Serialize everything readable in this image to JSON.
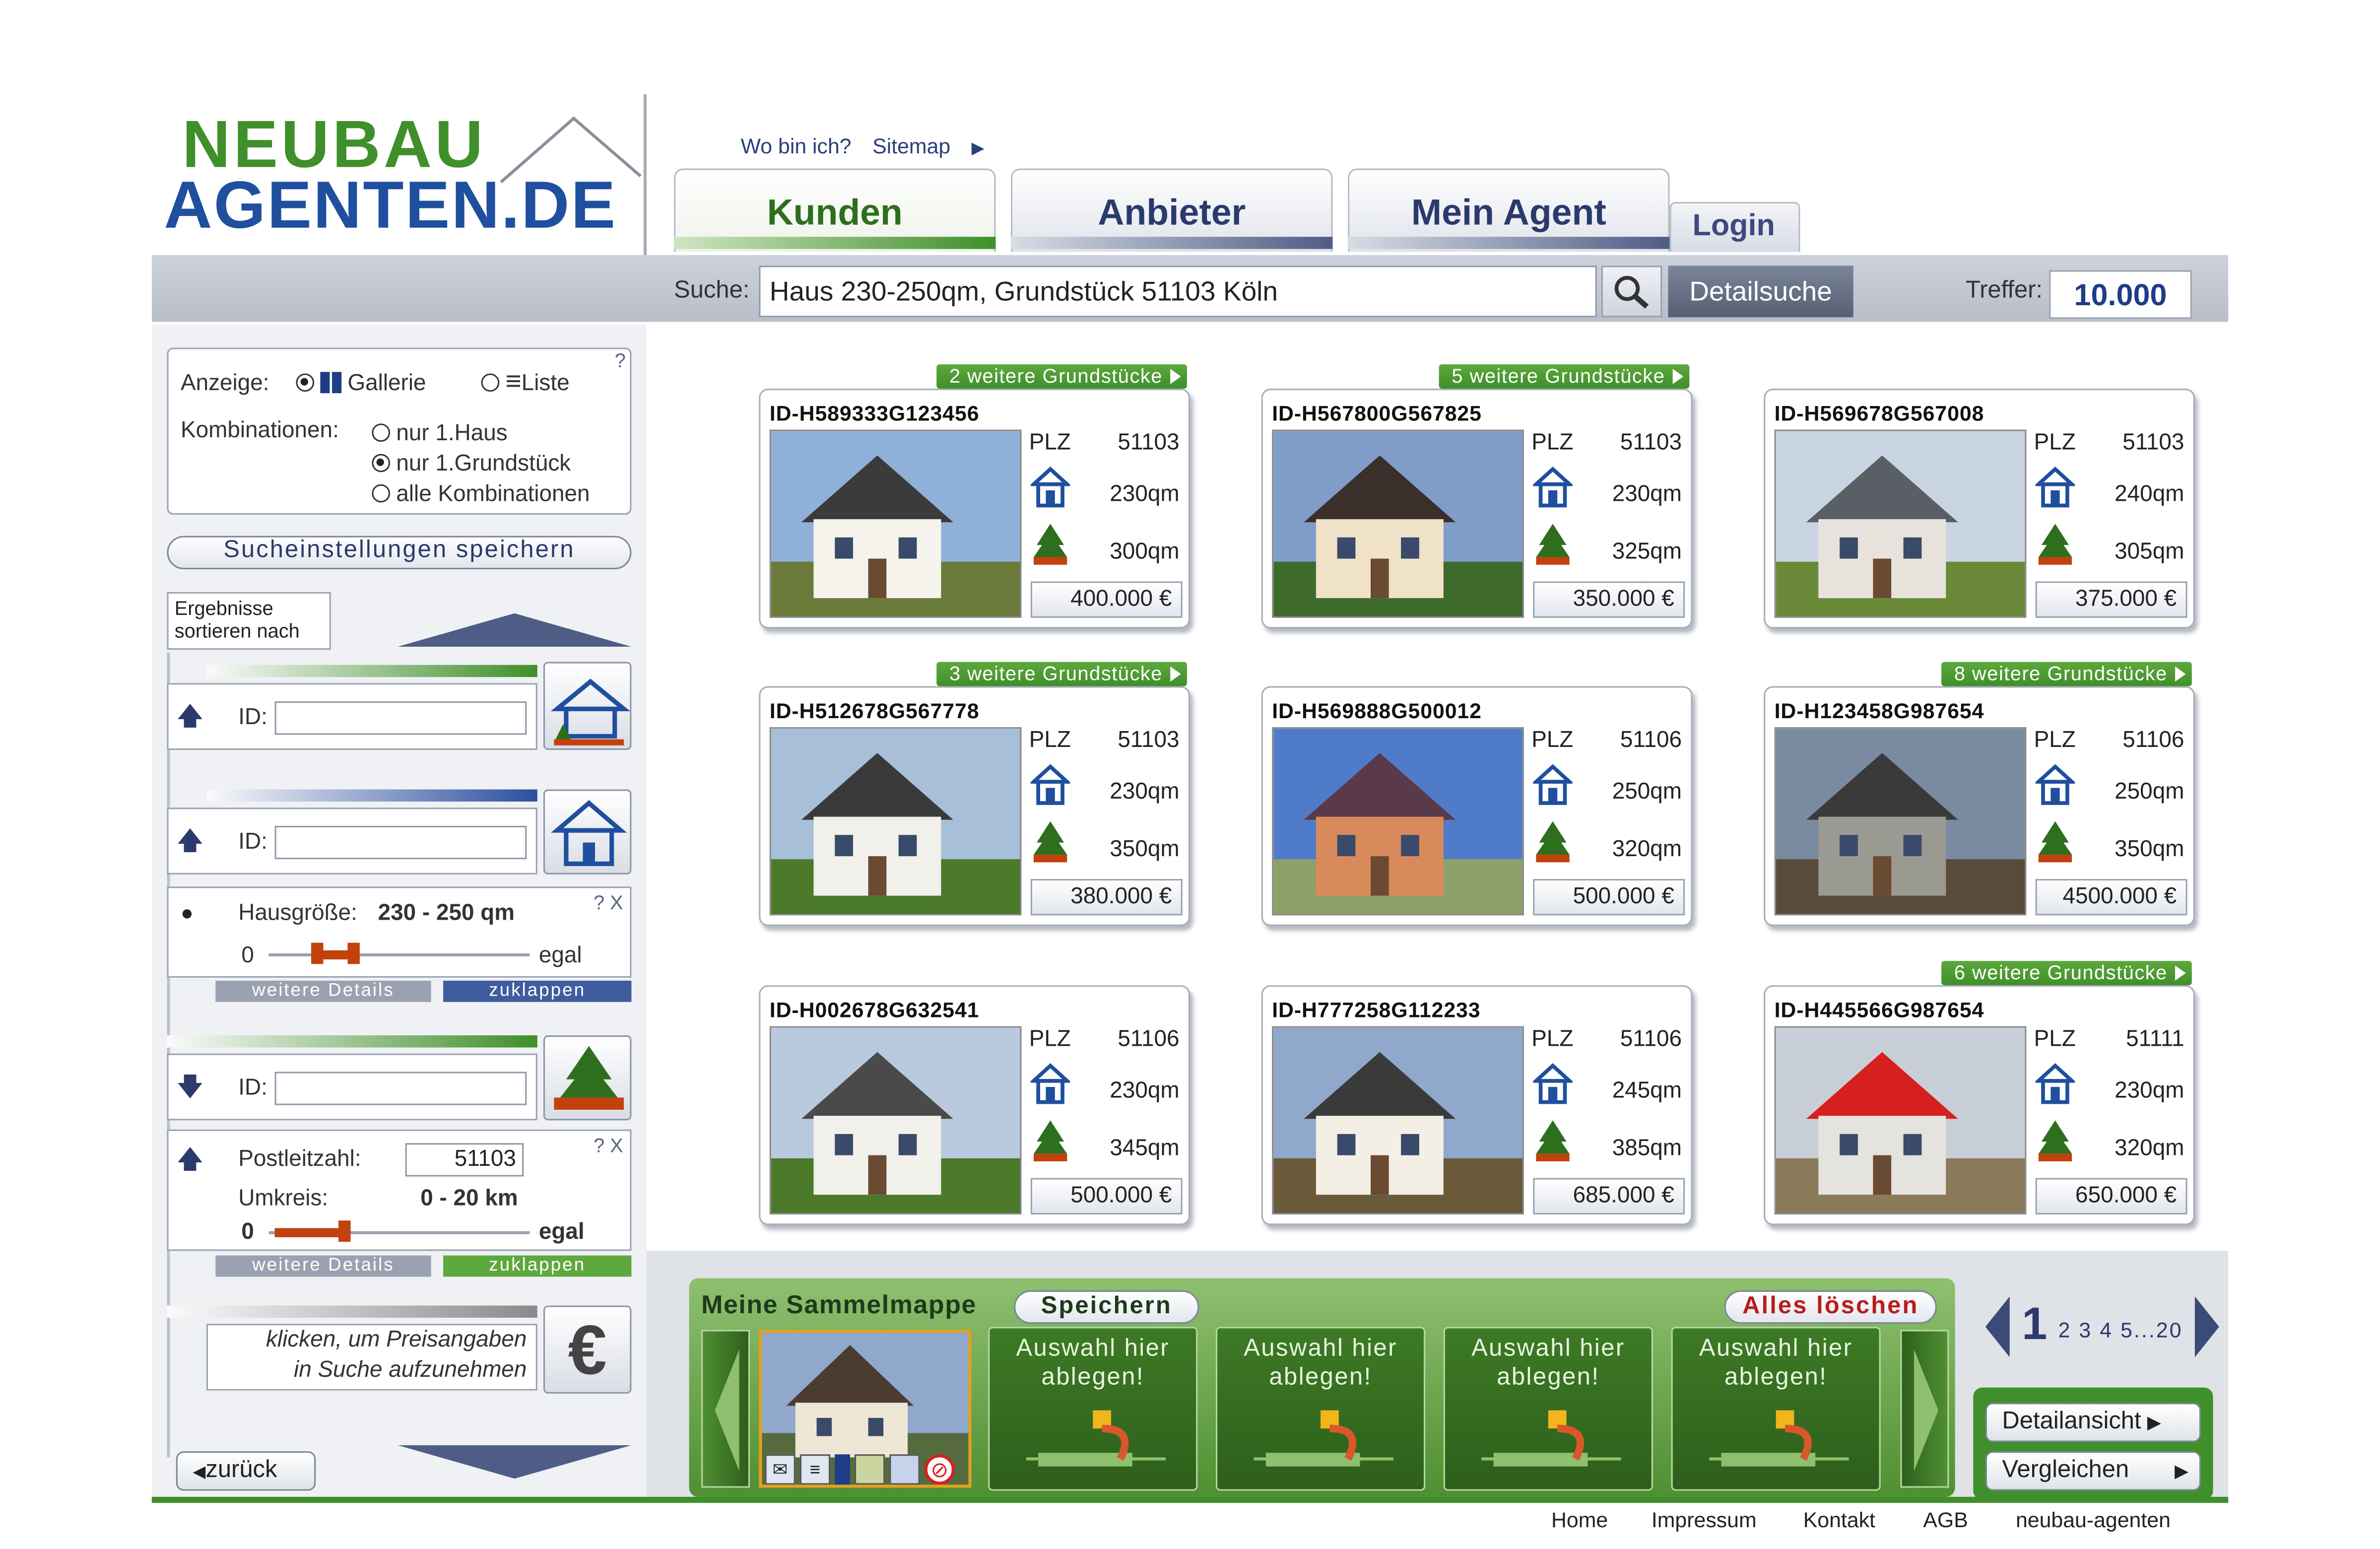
{
  "header": {
    "logo_line1": "NEUBAU",
    "logo_line2": "AGENTEN.DE",
    "breadcrumb": {
      "where": "Wo bin ich?",
      "sitemap": "Sitemap"
    },
    "tabs": [
      {
        "label": "Kunden",
        "active": true
      },
      {
        "label": "Anbieter",
        "active": false
      },
      {
        "label": "Mein Agent",
        "active": false
      }
    ],
    "login": "Login"
  },
  "search": {
    "label": "Suche:",
    "value": "Haus 230-250qm, Grundstück 51103 Köln",
    "detail_button": "Detailsuche",
    "hits_label": "Treffer:",
    "hits_value": "10.000"
  },
  "sidebar": {
    "display_label": "Anzeige:",
    "display_options": [
      "Gallerie",
      "Liste"
    ],
    "combinations_label": "Kombinationen:",
    "combination_options": [
      "nur 1.Haus",
      "nur 1.Grundstück",
      "alle Kombinationen"
    ],
    "help": "?",
    "save_settings": "Sucheinstellungen speichern",
    "sort_label": "Ergebnisse sortieren nach",
    "id_label": "ID:",
    "house_size_label": "Hausgröße:",
    "house_size_value": "230 - 250 qm",
    "range_min": "0",
    "range_max": "egal",
    "more_details": "weitere Details",
    "collapse": "zuklappen",
    "help_close": "? X",
    "postcode_label": "Postleitzahl:",
    "postcode_value": "51103",
    "radius_label": "Umkreis:",
    "radius_value": "0 - 20 km",
    "price_hint_line1": "klicken, um Preisangaben",
    "price_hint_line2": "in Suche aufzunehmen",
    "euro": "€",
    "back": "zurück"
  },
  "listings": [
    {
      "more": "2 weitere Grundstücke",
      "id": "ID-H589333G123456",
      "plz": "51103",
      "house": "230qm",
      "plot": "300qm",
      "price": "400.000 €"
    },
    {
      "more": "5 weitere Grundstücke",
      "id": "ID-H567800G567825",
      "plz": "51103",
      "house": "230qm",
      "plot": "325qm",
      "price": "350.000 €"
    },
    {
      "more": "",
      "id": "ID-H569678G567008",
      "plz": "51103",
      "house": "240qm",
      "plot": "305qm",
      "price": "375.000 €"
    },
    {
      "more": "3 weitere Grundstücke",
      "id": "ID-H512678G567778",
      "plz": "51103",
      "house": "230qm",
      "plot": "350qm",
      "price": "380.000 €"
    },
    {
      "more": "",
      "id": "ID-H569888G500012",
      "plz": "51106",
      "house": "250qm",
      "plot": "320qm",
      "price": "500.000 €"
    },
    {
      "more": "8 weitere Grundstücke",
      "id": "ID-H123458G987654",
      "plz": "51106",
      "house": "250qm",
      "plot": "350qm",
      "price": "4500.000 €"
    },
    {
      "more": "",
      "id": "ID-H002678G632541",
      "plz": "51106",
      "house": "230qm",
      "plot": "345qm",
      "price": "500.000 €"
    },
    {
      "more": "",
      "id": "ID-H777258G112233",
      "plz": "51106",
      "house": "245qm",
      "plot": "385qm",
      "price": "685.000 €"
    },
    {
      "more": "6 weitere Grundstücke",
      "id": "ID-H445566G987654",
      "plz": "51111",
      "house": "230qm",
      "plot": "320qm",
      "price": "650.000 €"
    }
  ],
  "card_labels": {
    "plz": "PLZ"
  },
  "collection": {
    "title": "Meine Sammelmappe",
    "save": "Speichern",
    "clear": "Alles löschen",
    "slot_text": "Auswahl hier ablegen!"
  },
  "pagination": {
    "current": "1",
    "others": "2 3 4 5...20"
  },
  "actions": {
    "detail": "Detailansicht",
    "compare": "Vergleichen"
  },
  "footer": [
    "Home",
    "Impressum",
    "Kontakt",
    "AGB",
    "neubau-agenten"
  ],
  "colors": {
    "brand_green": "#3f8f2a",
    "brand_blue": "#1f4f9e"
  }
}
